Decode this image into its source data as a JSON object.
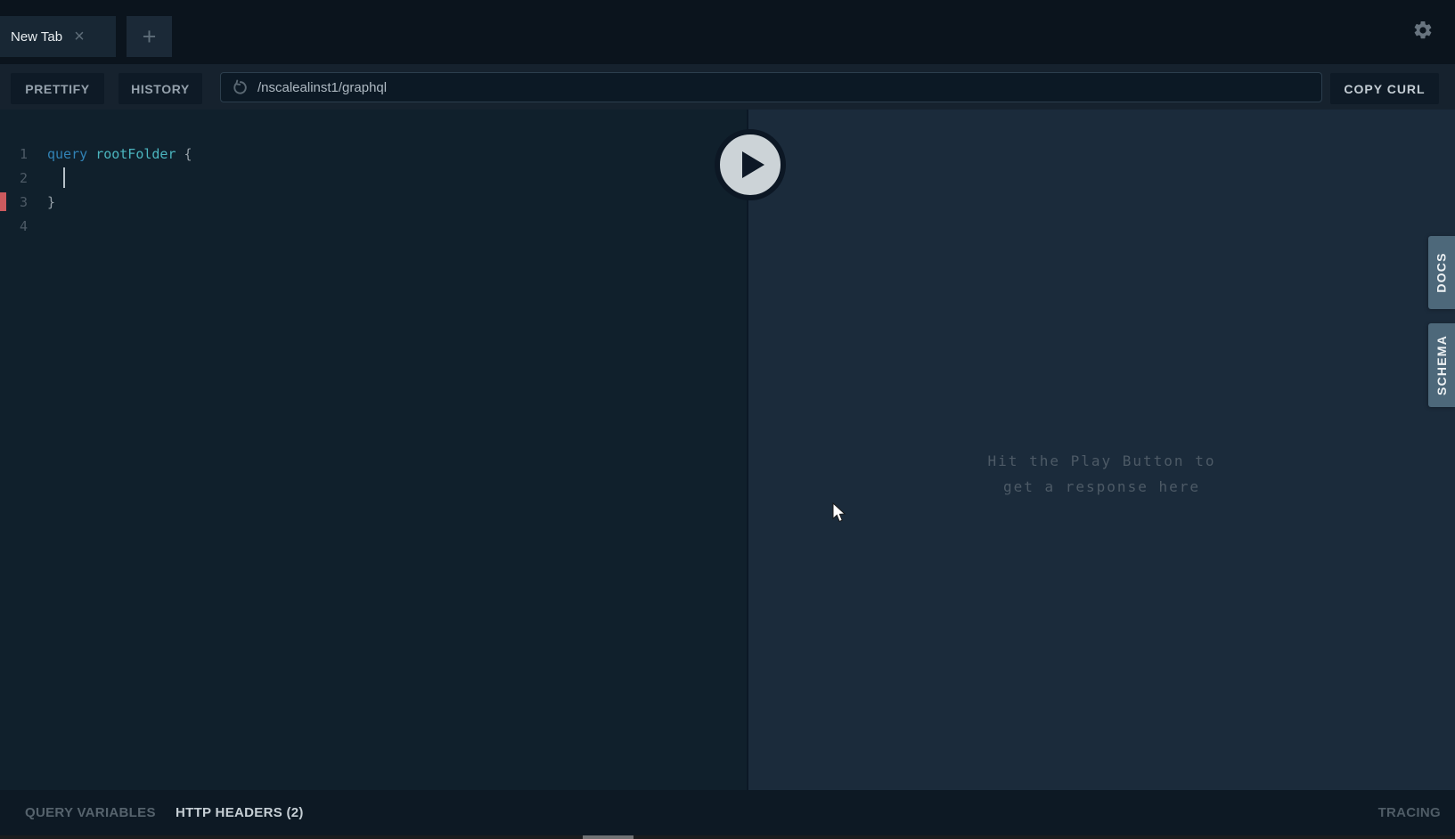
{
  "tabs": {
    "active_label": "New Tab",
    "close_glyph": "×",
    "new_tab_glyph": "+"
  },
  "toolbar": {
    "prettify_label": "PRETTIFY",
    "history_label": "HISTORY",
    "endpoint_value": "/nscalealinst1/graphql",
    "copy_curl_label": "COPY CURL"
  },
  "editor": {
    "lines": [
      {
        "num": "1",
        "tokens": [
          {
            "t": "query",
            "c": "kw"
          },
          {
            "t": " ",
            "c": "pl"
          },
          {
            "t": "rootFolder",
            "c": "def"
          },
          {
            "t": " {",
            "c": "pn"
          }
        ]
      },
      {
        "num": "2",
        "tokens": [
          {
            "t": "  ",
            "c": "pl"
          }
        ],
        "cursor": true
      },
      {
        "num": "3",
        "tokens": [
          {
            "t": "}",
            "c": "pn"
          }
        ],
        "error": true
      },
      {
        "num": "4",
        "tokens": []
      }
    ]
  },
  "response": {
    "placeholder_line1": "Hit the Play Button to",
    "placeholder_line2": "get a response here"
  },
  "side_tabs": {
    "docs_label": "DOCS",
    "schema_label": "SCHEMA"
  },
  "footer": {
    "query_variables_label": "QUERY VARIABLES",
    "http_headers_label": "HTTP HEADERS (2)",
    "tracing_label": "TRACING"
  },
  "colors": {
    "keyword": "#3182b5",
    "definition": "#4bb5bf",
    "punctuation": "#96a0a8",
    "error_marker": "#cc5a5e",
    "side_tab_bg": "#4d687a",
    "play_button": "#ccd3d7"
  }
}
